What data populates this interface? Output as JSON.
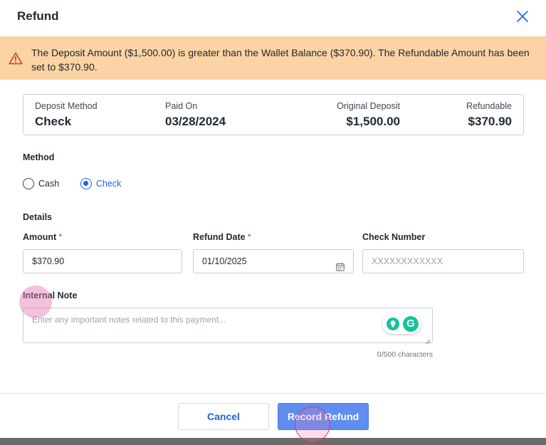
{
  "modal": {
    "title": "Refund",
    "close_icon": "close-icon"
  },
  "alert": {
    "icon": "warning-icon",
    "message": "The Deposit Amount ($1,500.00) is greater than the Wallet Balance ($370.90). The Refundable Amount has been set to $370.90.",
    "background": "#fbd3a5"
  },
  "summary": {
    "deposit_method_label": "Deposit Method",
    "deposit_method_value": "Check",
    "paid_on_label": "Paid On",
    "paid_on_value": "03/28/2024",
    "original_deposit_label": "Original Deposit",
    "original_deposit_value": "$1,500.00",
    "refundable_label": "Refundable",
    "refundable_value": "$370.90"
  },
  "method": {
    "label": "Method",
    "options": [
      {
        "label": "Cash",
        "checked": false
      },
      {
        "label": "Check",
        "checked": true
      }
    ]
  },
  "details": {
    "label": "Details",
    "amount_label": "Amount",
    "amount_value": "$370.90",
    "refund_date_label": "Refund Date",
    "refund_date_value": "01/10/2025",
    "check_number_label": "Check Number",
    "check_number_placeholder": "XXXXXXXXXXXX",
    "required_mark": "*"
  },
  "internal_note": {
    "label": "Internal Note",
    "placeholder": "Enter any important notes related to this payment...",
    "char_count": "0/500 characters"
  },
  "footer": {
    "cancel_label": "Cancel",
    "record_label": "Record Refund"
  },
  "colors": {
    "accent": "#1a66e0",
    "primary_button": "#5f8df0",
    "required": "#d93a3a"
  }
}
